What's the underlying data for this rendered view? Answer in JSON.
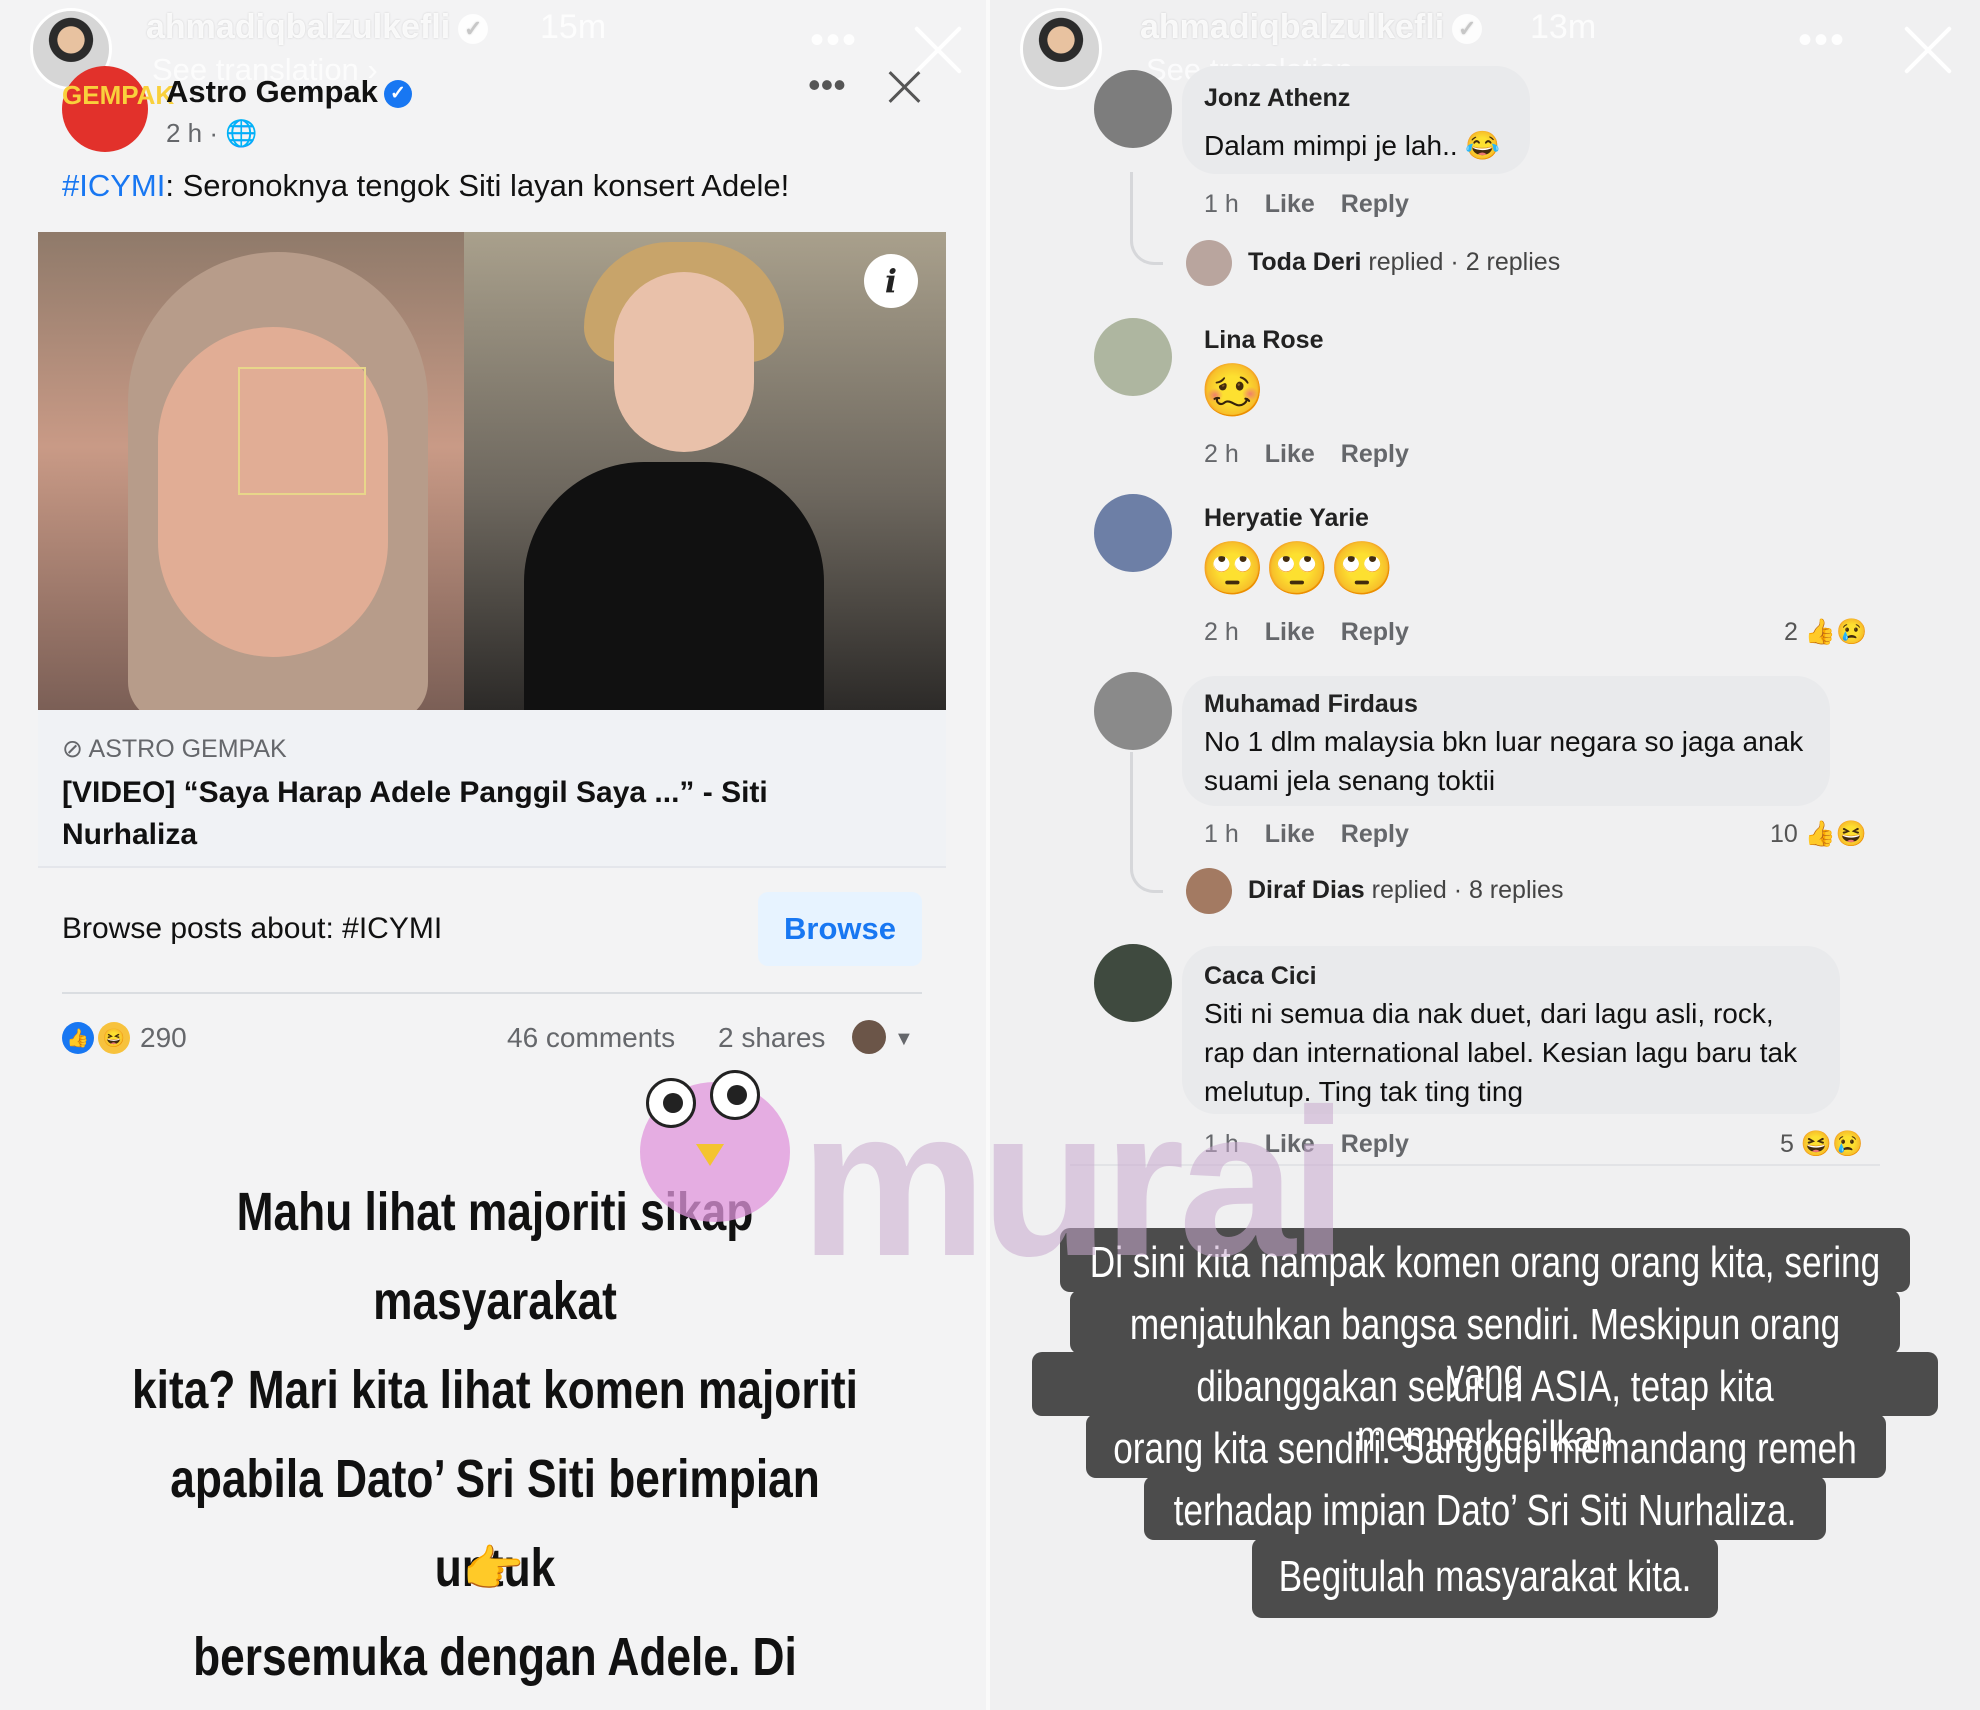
{
  "left_story": {
    "username": "ahmadiqbalzulkefli",
    "time": "15m",
    "see_translation": "See translation",
    "more": "•••",
    "post": {
      "page_logo_text": "GEMPAK",
      "page_name": "Astro Gempak",
      "meta": "2 h · 🌐",
      "hashtag": "#ICYMI",
      "caption_rest": ": Seronoknya tengok Siti layan konsert Adele!",
      "info_icon": "i",
      "link_domain": "ASTRO GEMPAK",
      "link_title": "[VIDEO] “Saya Harap Adele Panggil Saya ...” - Siti Nurhaliza",
      "browse_label": "Browse posts about: #ICYMI",
      "browse_button": "Browse",
      "reaction_count": "290",
      "comments": "46 comments",
      "shares": "2 shares",
      "icon_like": "👍",
      "icon_haha": "😆",
      "caret": "▼"
    },
    "text_lines": [
      "Mahu lihat majoriti sikap masyarakat",
      "kita? Mari kita lihat komen majoriti",
      "apabila Dato’ Sri Siti berimpian untuk",
      "bersemuka dengan Adele. Di sebelah"
    ],
    "pointer_emoji": "👉"
  },
  "watermark": "murai",
  "right_story": {
    "username": "ahmadiqbalzulkefli",
    "time": "13m",
    "see_translation": "See translation",
    "more": "•••",
    "comments": [
      {
        "name": "Jonz Athenz",
        "text": "Dalam mimpi je lah.. 😂",
        "time": "1 h",
        "like": "Like",
        "reply": "Reply"
      },
      {
        "name": "Lina Rose",
        "emoji": "🥴",
        "time": "2 h",
        "like": "Like",
        "reply": "Reply"
      },
      {
        "name": "Heryatie Yarie",
        "emoji": "🙄🙄🙄",
        "time": "2 h",
        "like": "Like",
        "reply": "Reply",
        "reaction_count": "2"
      },
      {
        "name": "Muhamad Firdaus",
        "text_lines": [
          "No 1 dlm malaysia bkn luar negara so jaga anak",
          "suami jela senang toktii"
        ],
        "time": "1 h",
        "like": "Like",
        "reply": "Reply",
        "reaction_count": "10"
      },
      {
        "name": "Caca Cici",
        "text_lines": [
          "Siti ni semua dia nak duet, dari lagu asli, rock,",
          "rap dan international label. Kesian lagu baru tak",
          "melutup. Ting tak ting ting"
        ],
        "time": "1 h",
        "like": "Like",
        "reply": "Reply",
        "reaction_count": "5"
      }
    ],
    "replies": [
      {
        "name": "Toda Deri",
        "replied": "replied",
        "count": "· 2 replies"
      },
      {
        "name": "Diraf Dias",
        "replied": "replied",
        "count": "· 8 replies"
      }
    ],
    "caption_lines": [
      "Di sini kita nampak komen orang orang kita, sering",
      "menjatuhkan bangsa sendiri. Meskipun orang yang",
      "dibanggakan seluruh ASIA, tetap kita memperkecilkan",
      "orang kita sendiri. Sanggup memandang remeh",
      "terhadap impian Dato’ Sri Siti Nurhaliza.",
      "Begitulah masyarakat kita."
    ],
    "icon_like": "👍",
    "icon_sad": "😢",
    "icon_haha": "😆"
  }
}
